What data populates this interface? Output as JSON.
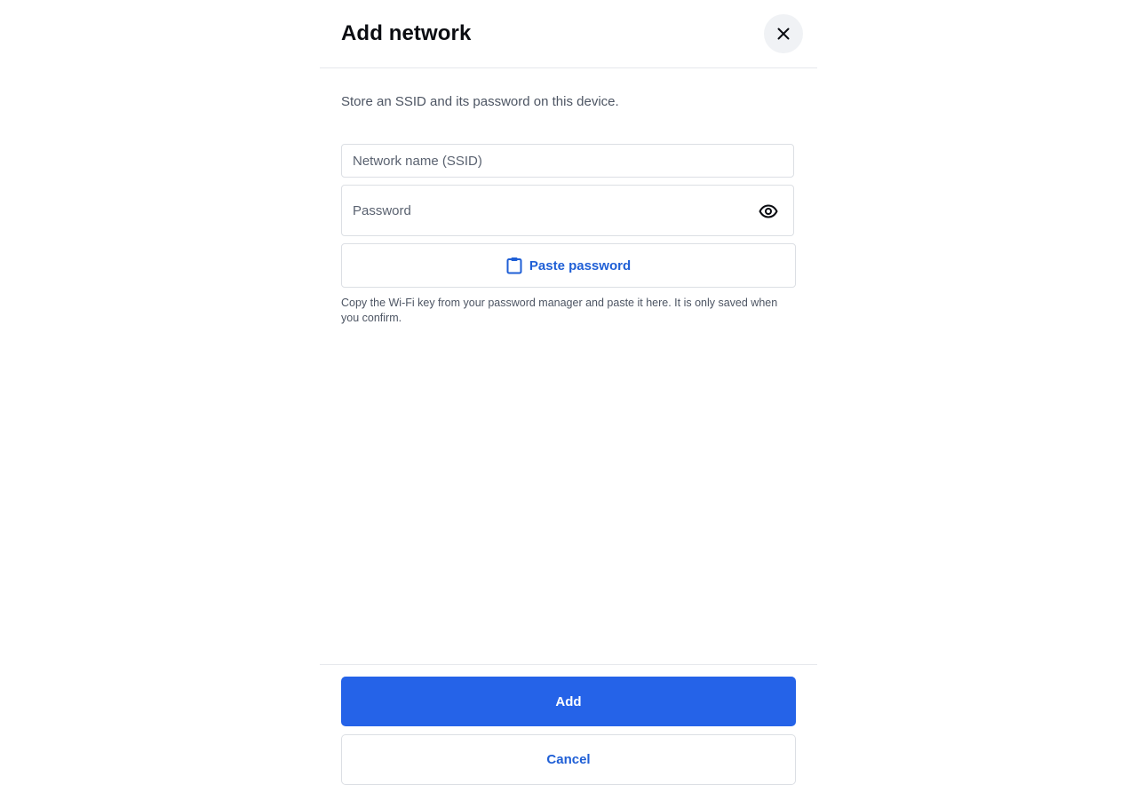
{
  "dialog": {
    "title": "Add network",
    "subtitle": "Store an SSID and its password on this device."
  },
  "form": {
    "ssid_placeholder": "Network name (SSID)",
    "ssid_value": "",
    "password_placeholder": "Password",
    "password_value": "",
    "paste_label": "Paste password",
    "hint": "Copy the Wi-Fi key from your password manager and paste it here. It is only saved when you confirm."
  },
  "footer": {
    "add_label": "Add",
    "cancel_label": "Cancel"
  },
  "icons": {
    "close": "close-icon",
    "eye": "eye-icon",
    "clipboard": "clipboard-icon"
  },
  "colors": {
    "primary": "#2563e8",
    "link": "#1f5fd6",
    "border": "#dcdfe4",
    "close_bg": "#f0f2f5"
  }
}
